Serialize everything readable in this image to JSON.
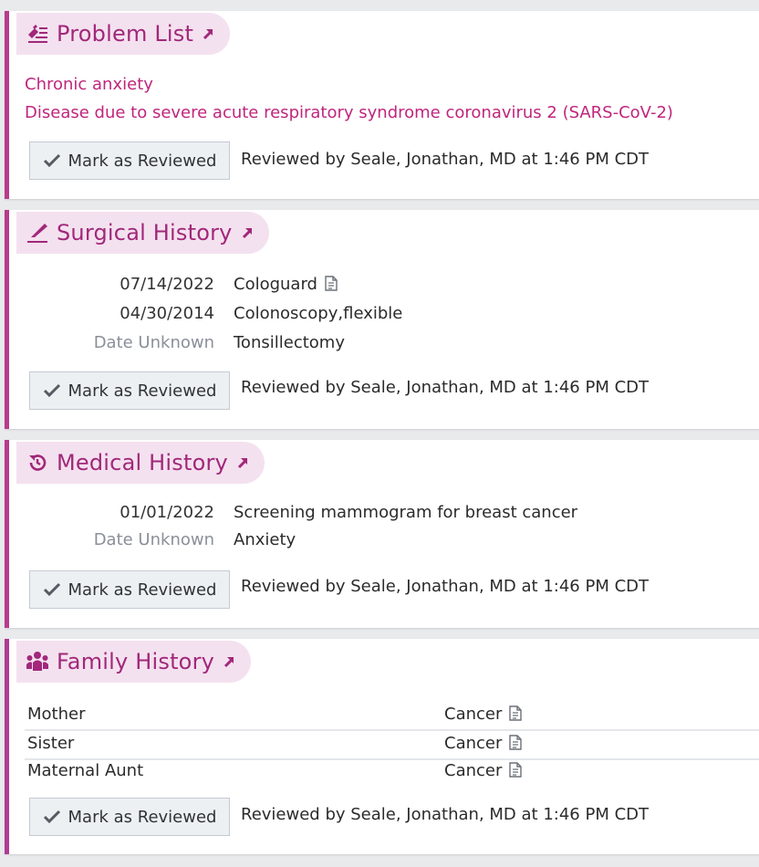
{
  "colors": {
    "accent": "#a1287a",
    "problem_text": "#c0257c",
    "pill_bg": "#f4e1ef",
    "section_border": "#b83a8d"
  },
  "problem_list": {
    "title": "Problem List",
    "icon": "problem-list-icon",
    "items": [
      "Chronic anxiety",
      "Disease due to severe acute respiratory syndrome coronavirus 2 (SARS-CoV-2)"
    ],
    "button": "Mark as Reviewed",
    "reviewed": "Reviewed by Seale, Jonathan, MD at 1:46 PM CDT"
  },
  "surgical_history": {
    "title": "Surgical History",
    "icon": "scalpel-icon",
    "items": [
      {
        "date": "07/14/2022",
        "desc": "Cologuard"
      },
      {
        "date": "04/30/2014",
        "desc": "Colonoscopy,flexible"
      },
      {
        "date": "Date Unknown",
        "desc": "Tonsillectomy"
      }
    ],
    "button": "Mark as Reviewed",
    "reviewed": "Reviewed by Seale, Jonathan, MD at 1:46 PM CDT"
  },
  "medical_history": {
    "title": "Medical History",
    "icon": "history-clock-icon",
    "items": [
      {
        "date": "01/01/2022",
        "desc": "Screening mammogram for breast cancer"
      },
      {
        "date": "Date Unknown",
        "desc": "Anxiety"
      }
    ],
    "button": "Mark as Reviewed",
    "reviewed": "Reviewed by Seale, Jonathan, MD at 1:46 PM CDT"
  },
  "family_history": {
    "title": "Family History",
    "icon": "family-icon",
    "rows": [
      {
        "relation": "Mother",
        "condition": "Cancer"
      },
      {
        "relation": "Sister",
        "condition": "Cancer"
      },
      {
        "relation": "Maternal Aunt",
        "condition": "Cancer"
      }
    ],
    "button": "Mark as Reviewed",
    "reviewed": "Reviewed by Seale, Jonathan, MD at 1:46 PM CDT"
  }
}
